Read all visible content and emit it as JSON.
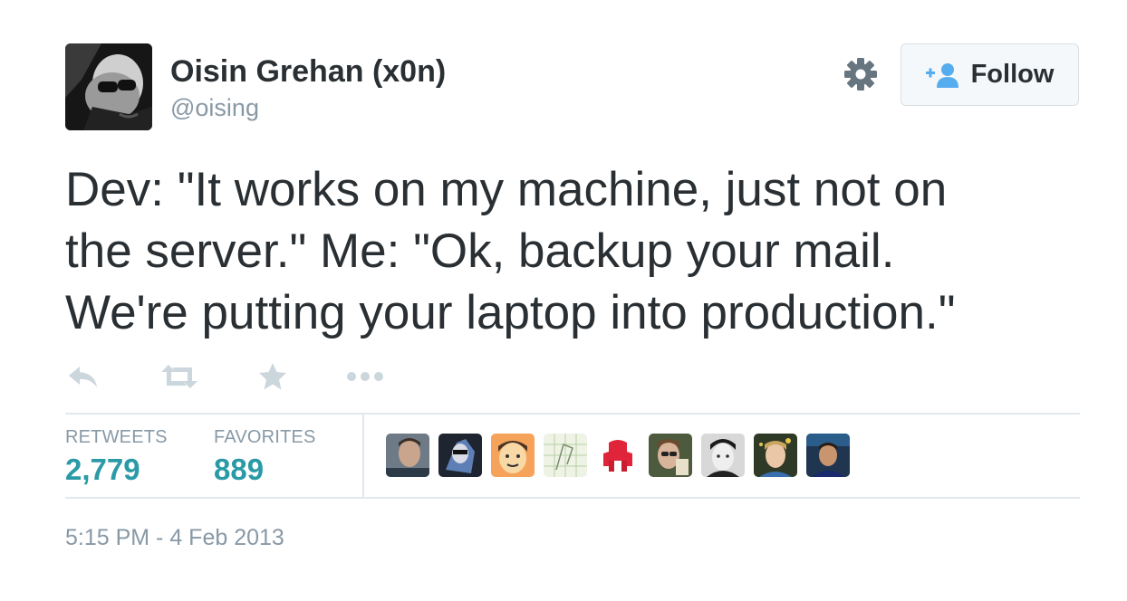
{
  "author": {
    "name": "Oisin Grehan (x0n)",
    "handle": "@oising"
  },
  "follow_button": {
    "label": "Follow",
    "icon": "follow-person-plus-icon"
  },
  "settings_icon": "gear-icon",
  "tweet": {
    "lines": [
      "Dev: \"It works on my machine, just not on",
      "the server.\" Me: \"Ok, backup your mail.",
      "We're putting your laptop into production.\""
    ]
  },
  "actions": [
    "reply-icon",
    "retweet-icon",
    "favorite-star-icon",
    "more-dots-icon"
  ],
  "stats": {
    "retweets_label": "RETWEETS",
    "retweets_value": "2,779",
    "favorites_label": "FAVORITES",
    "favorites_value": "889"
  },
  "facepile_count": 9,
  "timestamp": "5:15 PM - 4 Feb 2013",
  "colors": {
    "text": "#292f33",
    "muted": "#8899a6",
    "stat_value": "#2a9aa6",
    "follow_icon": "#55acee",
    "divider": "#e1e8ed"
  }
}
